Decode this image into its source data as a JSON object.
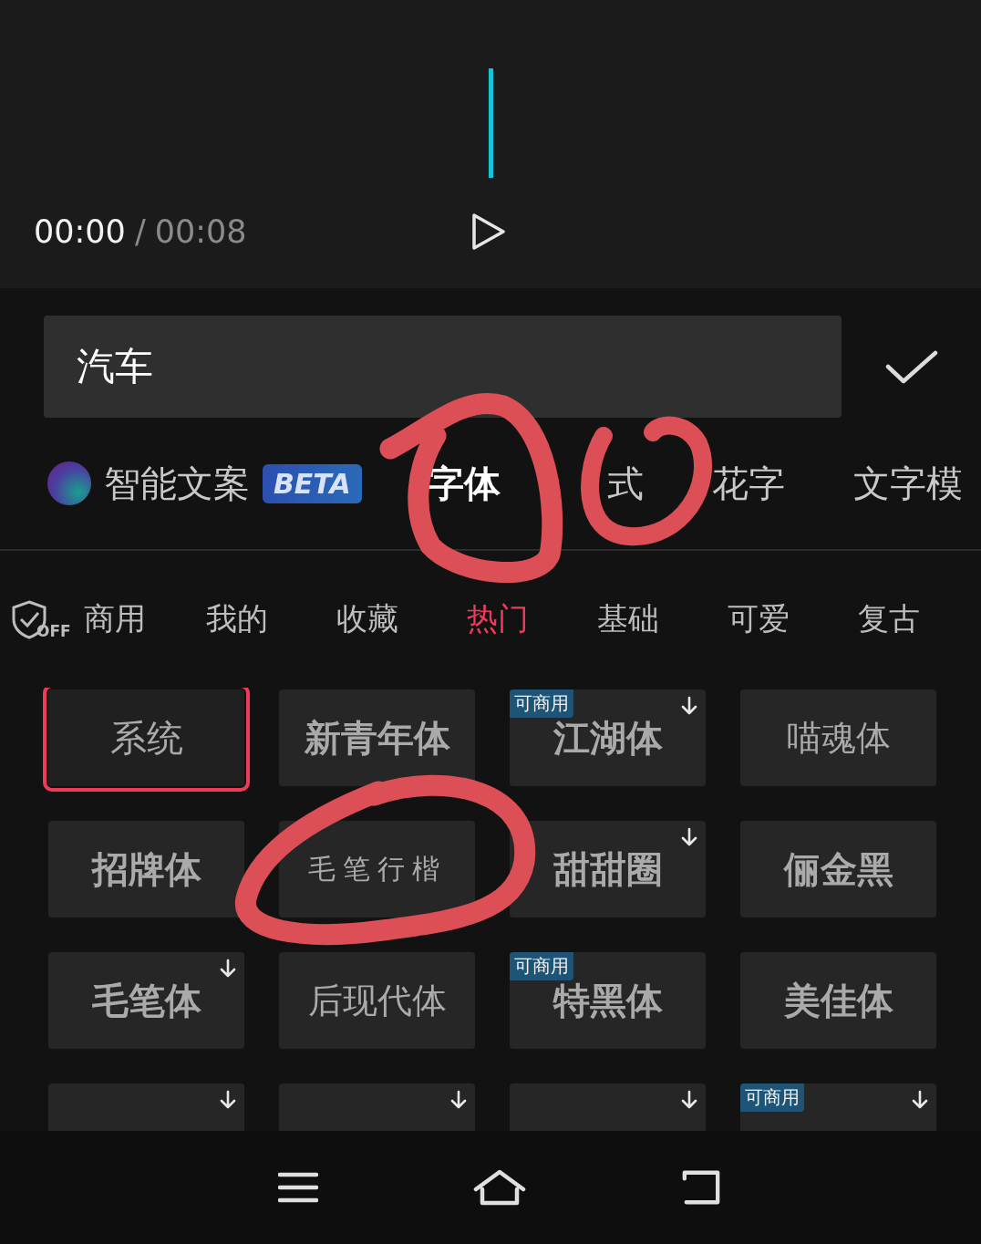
{
  "player": {
    "current_time": "00:00",
    "separator": "/",
    "duration": "00:08"
  },
  "text_input": {
    "value": "汽车"
  },
  "tabs": [
    {
      "label": "智能文案",
      "badge": "BETA",
      "kind": "ai",
      "selected": false
    },
    {
      "label": "字体",
      "kind": "plain",
      "selected": true
    },
    {
      "label": "式",
      "kind": "plain",
      "selected": false
    },
    {
      "label": "花字",
      "kind": "plain",
      "selected": false
    },
    {
      "label": "文字模",
      "kind": "plain",
      "selected": false
    }
  ],
  "commercial_filter": {
    "state": "OFF",
    "label": "商用"
  },
  "categories": [
    {
      "label": "我的",
      "selected": false
    },
    {
      "label": "收藏",
      "selected": false
    },
    {
      "label": "热门",
      "selected": true
    },
    {
      "label": "基础",
      "selected": false
    },
    {
      "label": "可爱",
      "selected": false
    },
    {
      "label": "复古",
      "selected": false
    }
  ],
  "fonts": [
    {
      "name": "系统",
      "kind": "plain",
      "selected": true,
      "downloadable": false
    },
    {
      "name": "新青年体",
      "kind": "heavy",
      "selected": false,
      "downloadable": false
    },
    {
      "name": "江湖体",
      "kind": "brush",
      "tag": "可商用",
      "selected": false,
      "downloadable": true
    },
    {
      "name": "喵魂体",
      "kind": "light",
      "selected": false,
      "downloadable": false
    },
    {
      "name": "招牌体",
      "kind": "brush",
      "selected": false,
      "downloadable": false
    },
    {
      "name": "毛笔行楷",
      "kind": "script",
      "selected": false,
      "downloadable": false
    },
    {
      "name": "甜甜圈",
      "kind": "heavy",
      "selected": false,
      "downloadable": true
    },
    {
      "name": "俪金黑",
      "kind": "heavy",
      "selected": false,
      "downloadable": false
    },
    {
      "name": "毛笔体",
      "kind": "brush",
      "selected": false,
      "downloadable": true
    },
    {
      "name": "后现代体",
      "kind": "light",
      "selected": false,
      "downloadable": false
    },
    {
      "name": "特黑体",
      "kind": "heavy",
      "tag": "可商用",
      "selected": false,
      "downloadable": false
    },
    {
      "name": "美佳体",
      "kind": "heavy",
      "selected": false,
      "downloadable": false
    },
    {
      "kind": "cut",
      "selected": false,
      "downloadable": true
    },
    {
      "kind": "cut",
      "selected": false,
      "downloadable": true
    },
    {
      "kind": "cut",
      "selected": false,
      "downloadable": true
    },
    {
      "kind": "cut",
      "tag": "可商用",
      "selected": false,
      "downloadable": true
    }
  ],
  "annotations": [
    {
      "kind": "circle"
    },
    {
      "kind": "hook"
    },
    {
      "kind": "circle"
    }
  ]
}
